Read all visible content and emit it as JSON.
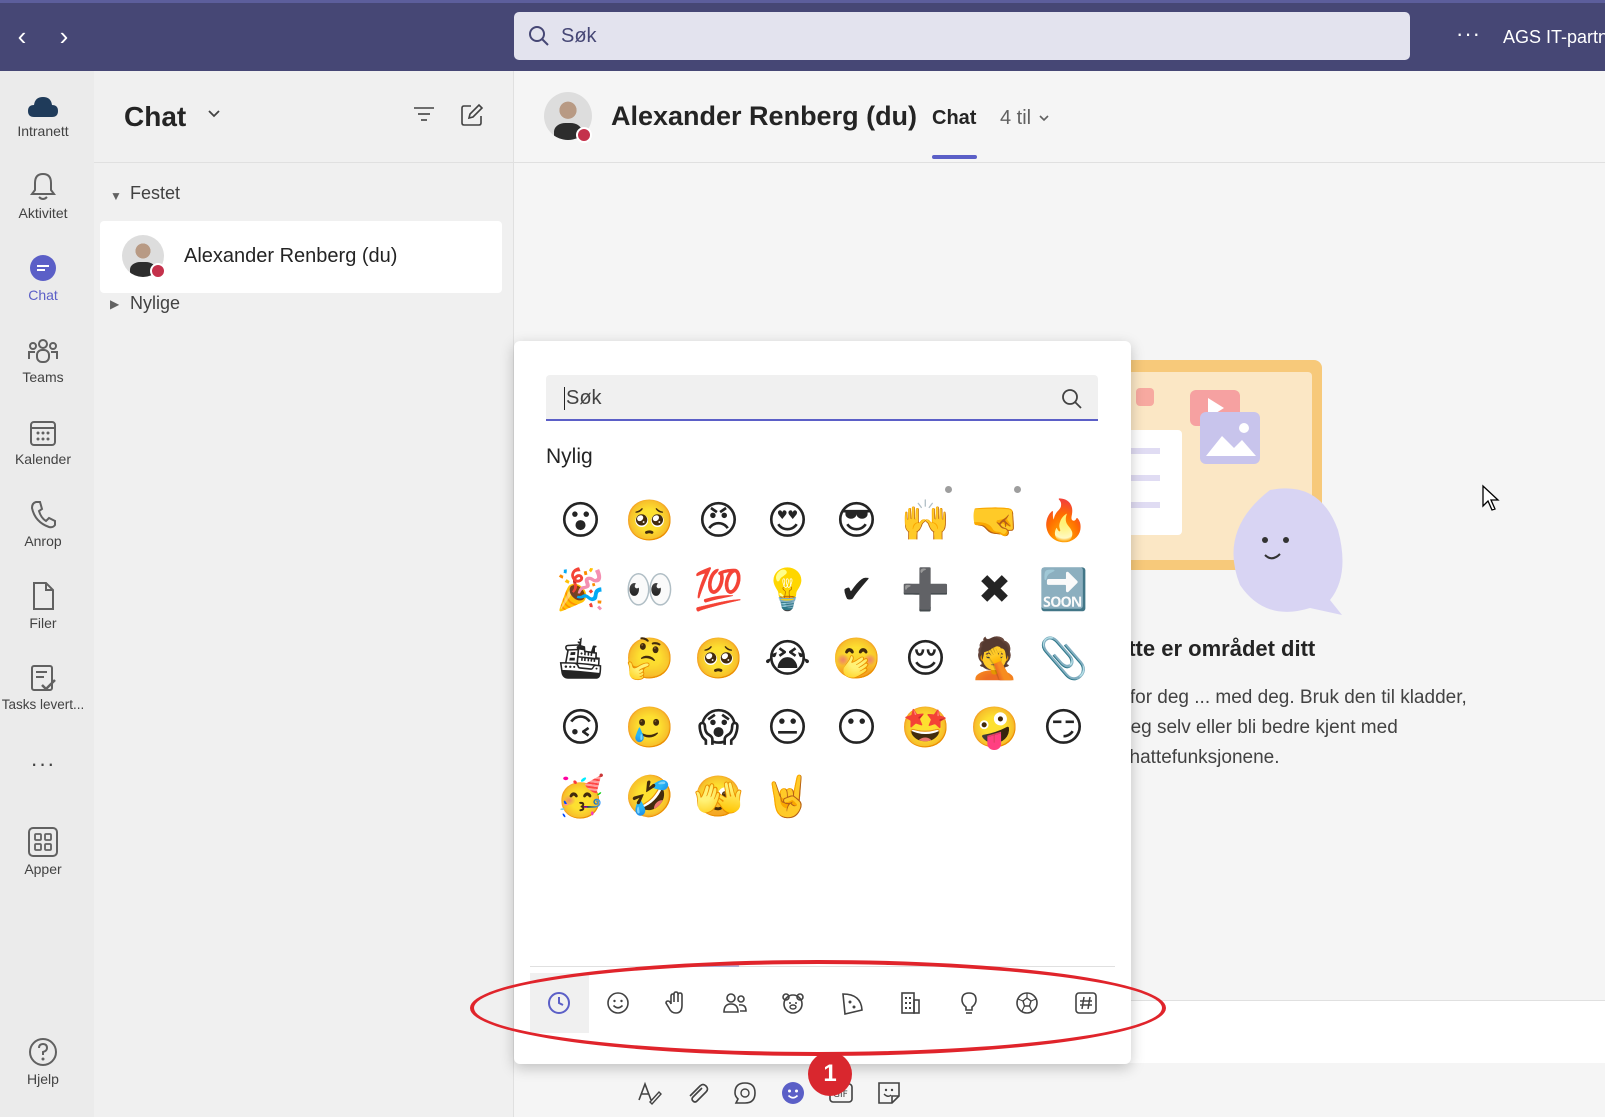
{
  "topbar": {
    "back": "‹",
    "forward": "›",
    "search_placeholder": "Søk",
    "more": "···",
    "org_name": "AGS IT-partner"
  },
  "rail": {
    "items": [
      {
        "label": "Intranett",
        "icon": "cloud-icon"
      },
      {
        "label": "Aktivitet",
        "icon": "bell-icon"
      },
      {
        "label": "Chat",
        "icon": "chat-icon",
        "active": true
      },
      {
        "label": "Teams",
        "icon": "teams-icon"
      },
      {
        "label": "Kalender",
        "icon": "calendar-icon"
      },
      {
        "label": "Anrop",
        "icon": "phone-icon"
      },
      {
        "label": "Filer",
        "icon": "file-icon"
      },
      {
        "label": "Tasks levert...",
        "icon": "tasks-icon"
      }
    ],
    "more": "···",
    "apps": "Apper",
    "help": "Hjelp"
  },
  "chatlist": {
    "title": "Chat",
    "pinned_label": "Festet",
    "pinned_chat_name": "Alexander Renberg (du)",
    "recent_label": "Nylige"
  },
  "conversation": {
    "name": "Alexander Renberg (du)",
    "tab_chat": "Chat",
    "tab_more": "4 til",
    "empty_title": "ette er området ditt",
    "empty_line1": "e for deg ... med deg. Bruk den til kladder,",
    "empty_line2": "deg selv eller bli bedre kjent med",
    "empty_line3": "chattefunksjonene."
  },
  "emoji_panel": {
    "search_placeholder": "Søk",
    "section_title": "Nylig",
    "emojis": [
      "😮",
      "🥺",
      "😠",
      "😍",
      "😎",
      "🙌",
      "🤜",
      "🔥",
      "🎉",
      "👀",
      "💯",
      "💡",
      "✔",
      "➕",
      "✖",
      "🔜",
      "🛳",
      "🤔",
      "🥺",
      "😭",
      "🤭",
      "😌",
      "🤦",
      "📎",
      "🙃",
      "🥲",
      "😱",
      "😐",
      "😶",
      "🤩",
      "🤪",
      "😏",
      "🥳",
      "🤣",
      "🫣",
      "🤘"
    ],
    "categories": [
      "recent-icon",
      "smiley-icon",
      "hand-icon",
      "people-icon",
      "animal-icon",
      "food-icon",
      "building-icon",
      "lightbulb-icon",
      "ball-icon",
      "symbol-icon"
    ]
  },
  "annotation": {
    "badge": "1",
    "color": "#e0242b"
  },
  "colors": {
    "brand": "#464775",
    "accent": "#5b5fc7",
    "presence_busy": "#c4314b"
  }
}
